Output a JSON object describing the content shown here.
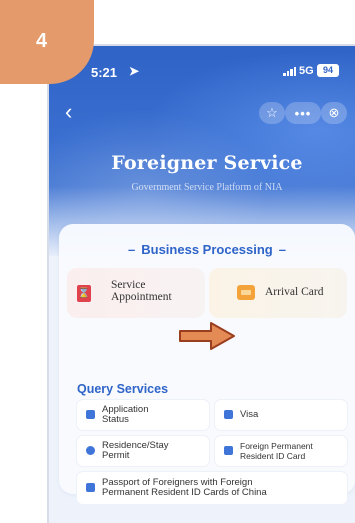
{
  "step_badge": "4",
  "status": {
    "time": "5:21",
    "network": "5G",
    "battery": "94"
  },
  "nav": {
    "back_icon": "chevron-left-icon",
    "star_icon": "star-icon",
    "more_icon": "more-icon",
    "close_icon": "close-circle-icon"
  },
  "header": {
    "title": "Foreigner Service",
    "subtitle": "Government Service Platform of NIA"
  },
  "business": {
    "title": "Business Processing",
    "buttons": [
      {
        "label_line1": "Service",
        "label_line2": "Appointment",
        "icon": "appointment-icon"
      },
      {
        "label": "Arrival Card",
        "icon": "arrival-card-icon"
      }
    ]
  },
  "query": {
    "title": "Query Services",
    "items": [
      {
        "line1": "Application",
        "line2": "Status",
        "icon": "list-icon"
      },
      {
        "line1": "Visa",
        "icon": "visa-icon"
      },
      {
        "line1": "Residence/Stay",
        "line2": "Permit",
        "icon": "permit-icon"
      },
      {
        "line1": "Foreign Permanent",
        "line2": "Resident ID Card",
        "icon": "id-card-icon"
      },
      {
        "line1": "Passport of Foreigners with Foreign",
        "line2": "Permanent Resident ID Cards of China",
        "icon": "passport-icon"
      }
    ]
  },
  "colors": {
    "accent": "#2f64c8",
    "badge": "#e49a6a",
    "arrow": "#e48a54"
  }
}
